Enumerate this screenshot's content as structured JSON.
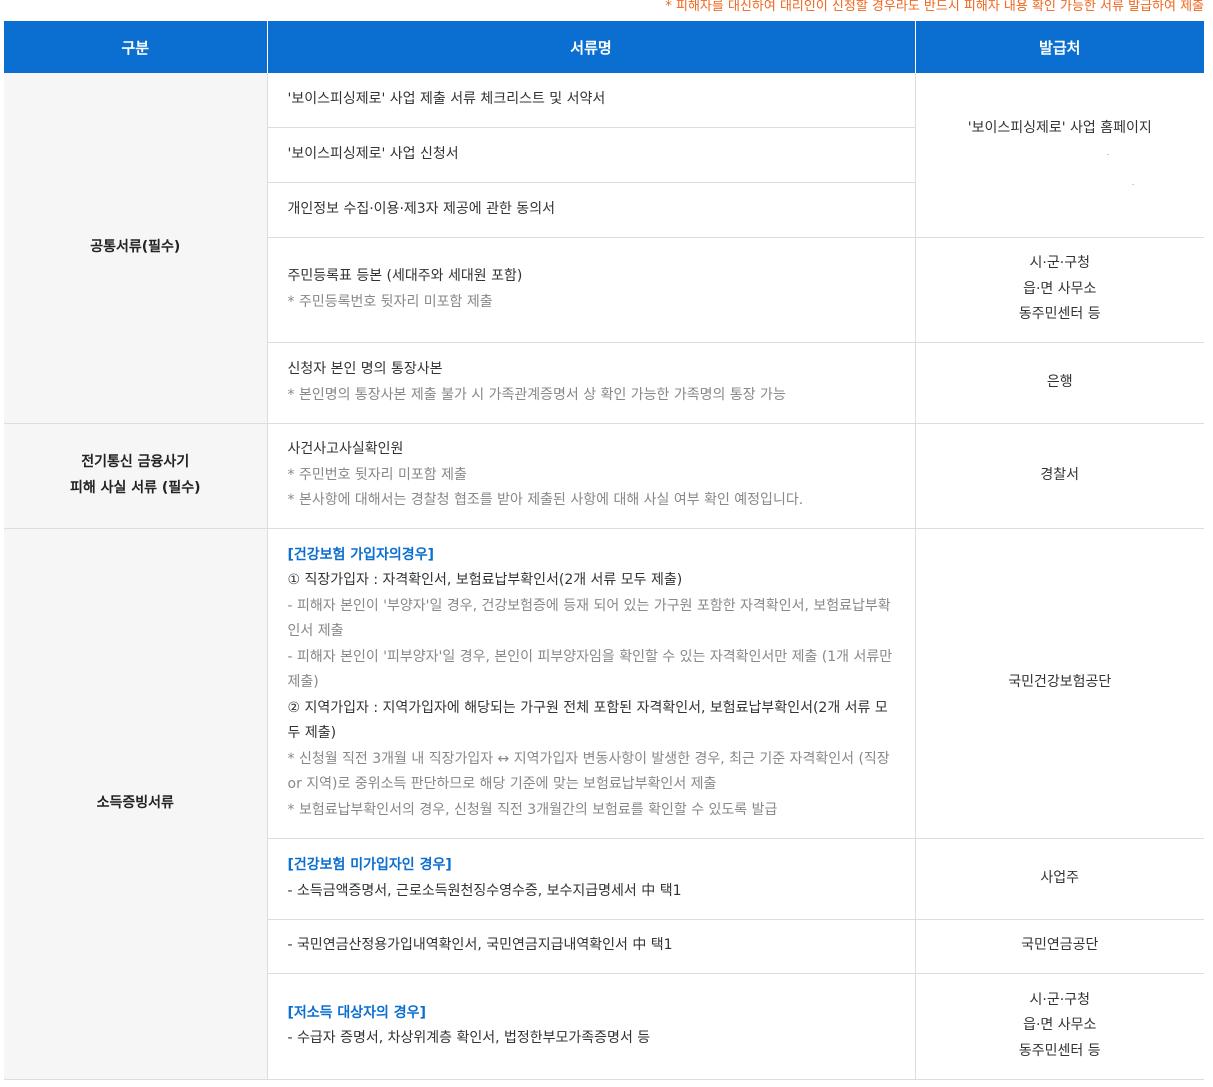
{
  "note": "* 피해자를 대신하여 대리인이 신청할 경우라도 반드시 피해자 내용 확인 가능한 서류 발급하여 제출",
  "header": {
    "col1": "구분",
    "col2": "서류명",
    "col3": "발급처"
  },
  "colors": {
    "header_bg": "#0a6fd0",
    "note": "#f0661e",
    "highlight": "#0a6fd0"
  },
  "sections": {
    "common": {
      "category": "공통서류(필수)",
      "docs": [
        "'보이스피싱제로' 사업 제출 서류 체크리스트 및 서약서",
        "'보이스피싱제로' 사업 신청서",
        "개인정보 수집·이용·제3자 제공에 관한 동의서"
      ],
      "issuer_homepage": "'보이스피싱제로' 사업 홈페이지",
      "resident": {
        "doc": "주민등록표 등본 (세대주와 세대원 포함)",
        "sub": "* 주민등록번호 뒷자리 미포함 제출",
        "issuer": [
          "시·군·구청",
          "읍·면 사무소",
          "동주민센터 등"
        ]
      },
      "bank": {
        "doc": "신청자 본인 명의 통장사본",
        "sub": "* 본인명의 통장사본 제출 불가 시 가족관계증명서 상 확인 가능한 가족명의 통장 가능",
        "issuer": "은행"
      }
    },
    "fraud": {
      "category_line1": "전기통신 금융사기",
      "category_line2": "피해 사실 서류 (필수)",
      "doc": "사건사고사실확인원",
      "sub1": "* 주민번호 뒷자리 미포함 제출",
      "sub2": "* 본사항에 대해서는 경찰청 협조를 받아 제출된 사항에 대해 사실 여부 확인 예정입니다.",
      "issuer": "경찰서"
    },
    "income": {
      "category": "소득증빙서류",
      "insured": {
        "title": "[건강보험 가입자의경우]",
        "line1": "① 직장가입자 : 자격확인서, 보험료납부확인서(2개 서류 모두 제출)",
        "line2": "- 피해자 본인이 '부양자'일 경우, 건강보험증에 등재 되어 있는 가구원 포함한 자격확인서, 보험료납부확인서 제출",
        "line3": "- 피해자 본인이 '피부양자'일 경우, 본인이 피부양자임을 확인할 수 있는 자격확인서만 제출 (1개 서류만 제출)",
        "line4": "② 지역가입자 : 지역가입자에 해당되는 가구원 전체 포함된 자격확인서, 보험료납부확인서(2개 서류 모두 제출)",
        "line5": "* 신청월 직전 3개월 내 직장가입자 ↔ 지역가입자 변동사항이 발생한 경우, 최근 기준 자격확인서 (직장 or 지역)로 중위소득 판단하므로 해당 기준에 맞는 보험료납부확인서 제출",
        "line6": "* 보험료납부확인서의 경우, 신청월 직전 3개월간의 보험료를 확인할 수 있도록 발급",
        "issuer": "국민건강보험공단"
      },
      "uninsured": {
        "title": "[건강보험 미가입자인 경우]",
        "line": "- 소득금액증명서, 근로소득원천징수영수증, 보수지급명세서 中 택1",
        "issuer": "사업주"
      },
      "pension": {
        "line": "- 국민연금산정용가입내역확인서, 국민연금지급내역확인서 中 택1",
        "issuer": "국민연금공단"
      },
      "low_income": {
        "title": "[저소득 대상자의 경우]",
        "line": "- 수급자 증명서, 차상위계층 확인서, 법정한부모가족증명서 등",
        "issuer": [
          "시·군·구청",
          "읍·면 사무소",
          "동주민센터 등"
        ]
      }
    }
  }
}
